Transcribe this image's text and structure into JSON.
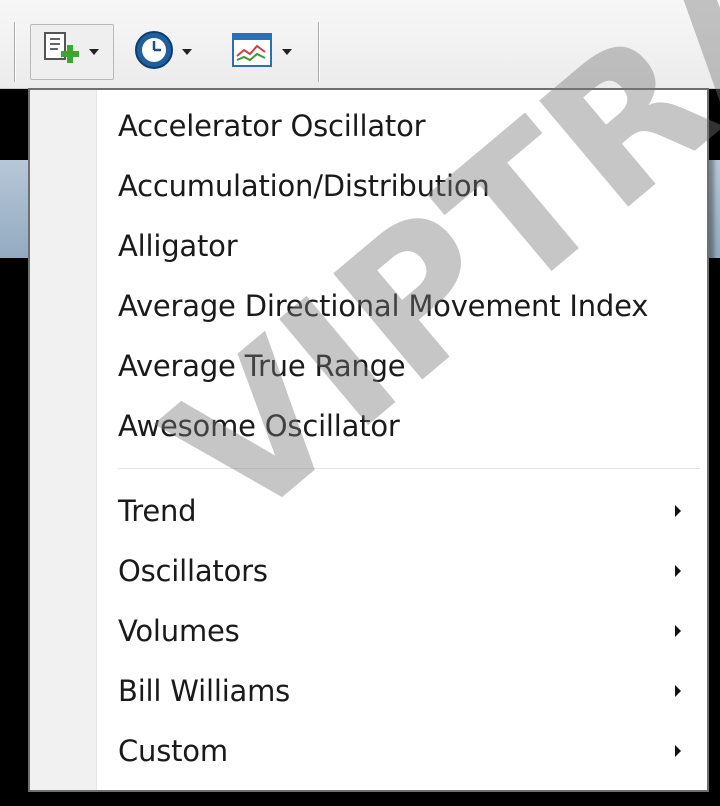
{
  "toolbar": {
    "buttons": [
      {
        "icon": "new-chart-icon",
        "has_dropdown": true
      },
      {
        "icon": "clock-icon",
        "has_dropdown": true
      },
      {
        "icon": "indicators-chart-icon",
        "has_dropdown": true
      }
    ]
  },
  "menu": {
    "items": [
      {
        "label": "Accelerator Oscillator"
      },
      {
        "label": "Accumulation/Distribution"
      },
      {
        "label": "Alligator"
      },
      {
        "label": "Average Directional Movement Index"
      },
      {
        "label": "Average True Range"
      },
      {
        "label": "Awesome Oscillator"
      }
    ],
    "submenus": [
      {
        "label": "Trend"
      },
      {
        "label": "Oscillators"
      },
      {
        "label": "Volumes"
      },
      {
        "label": "Bill Williams"
      },
      {
        "label": "Custom"
      }
    ]
  },
  "watermark": {
    "text": "VIPTRAD"
  },
  "colors": {
    "menu_background": "#ffffff",
    "menu_gutter": "#f1f1f1",
    "menu_border": "#6f6f6f",
    "chart_background": "#000000",
    "chart_header": "#a8bbcd"
  }
}
